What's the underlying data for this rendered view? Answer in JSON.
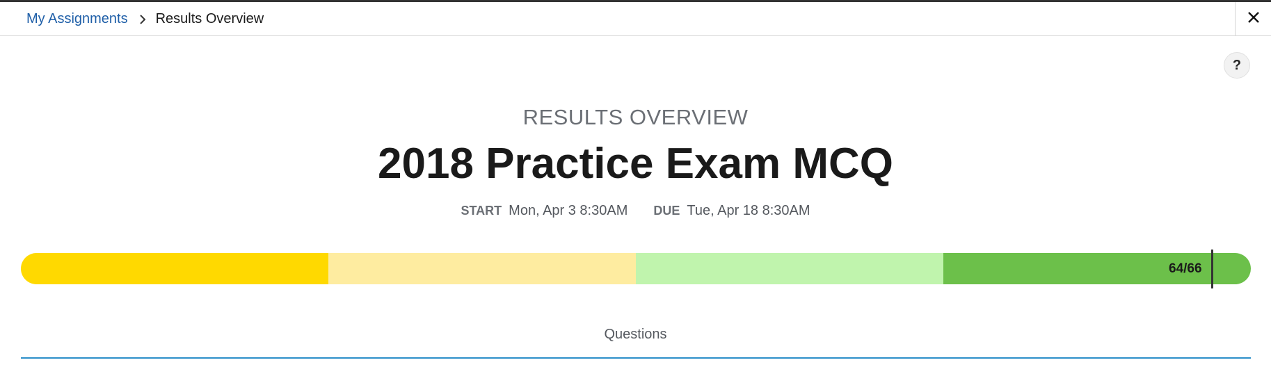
{
  "breadcrumb": {
    "parent": "My Assignments",
    "current": "Results Overview"
  },
  "help": {
    "label": "?"
  },
  "overview": {
    "overline": "RESULTS OVERVIEW",
    "title": "2018 Practice Exam MCQ",
    "start_label": "START",
    "start_value": "Mon, Apr 3 8:30AM",
    "due_label": "DUE",
    "due_value": "Tue, Apr 18 8:30AM"
  },
  "progress": {
    "score": 64,
    "total": 66,
    "score_text": "64/66",
    "segment_colors": [
      "#ffd900",
      "#feeca0",
      "#c0f4ad",
      "#6cc04a"
    ]
  },
  "tabs": {
    "questions": "Questions"
  },
  "colors": {
    "link": "#1f5fa8",
    "tab_accent": "#2c8fc9"
  },
  "icons": {
    "breadcrumb_separator": "chevron-right-icon",
    "close": "close-icon"
  }
}
